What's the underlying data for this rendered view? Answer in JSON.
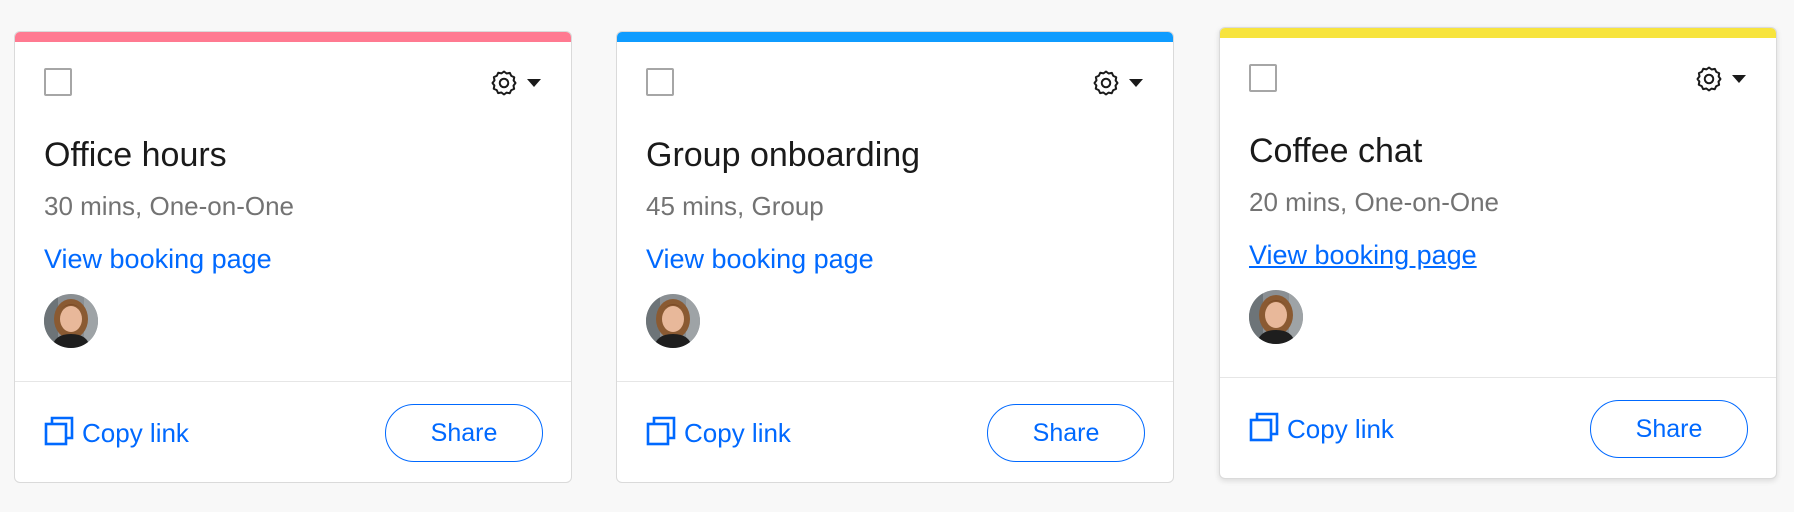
{
  "colors": {
    "link": "#0069ff",
    "card_0_stripe": "#ff7a91",
    "card_1_stripe": "#0f9cff",
    "card_2_stripe": "#f7e43d"
  },
  "cards": [
    {
      "title": "Office hours",
      "meta": "30 mins, One-on-One",
      "link_label": "View booking page",
      "copy_label": "Copy link",
      "share_label": "Share",
      "stripe_color": "#ff7a91"
    },
    {
      "title": "Group onboarding",
      "meta": "45 mins, Group",
      "link_label": "View booking page",
      "copy_label": "Copy link",
      "share_label": "Share",
      "stripe_color": "#0f9cff"
    },
    {
      "title": "Coffee chat",
      "meta": "20 mins, One-on-One",
      "link_label": "View booking page",
      "copy_label": "Copy link",
      "share_label": "Share",
      "stripe_color": "#f7e43d"
    }
  ],
  "icons": {
    "settings": "gear-icon",
    "dropdown": "caret-down-icon",
    "copy": "copy-icon",
    "avatar": "user-avatar"
  }
}
